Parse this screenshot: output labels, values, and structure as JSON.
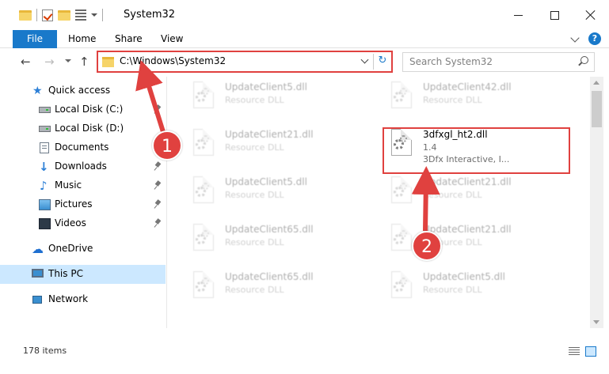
{
  "window": {
    "title": "System32"
  },
  "ribbon": {
    "tabs": [
      {
        "label": "File"
      },
      {
        "label": "Home"
      },
      {
        "label": "Share"
      },
      {
        "label": "View"
      }
    ]
  },
  "nav": {
    "address": "C:\\Windows\\System32",
    "search_placeholder": "Search System32"
  },
  "sidebar": {
    "items": [
      {
        "label": "Quick access",
        "icon": "star-icon"
      },
      {
        "label": "Local Disk (C:)",
        "icon": "drive-icon"
      },
      {
        "label": "Local Disk (D:)",
        "icon": "drive-icon"
      },
      {
        "label": "Documents",
        "icon": "documents-icon"
      },
      {
        "label": "Downloads",
        "icon": "download-icon"
      },
      {
        "label": "Music",
        "icon": "music-icon"
      },
      {
        "label": "Pictures",
        "icon": "pictures-icon"
      },
      {
        "label": "Videos",
        "icon": "videos-icon"
      },
      {
        "label": "OneDrive",
        "icon": "cloud-icon"
      },
      {
        "label": "This PC",
        "icon": "computer-icon"
      },
      {
        "label": "Network",
        "icon": "network-icon"
      }
    ]
  },
  "files": [
    {
      "name": "UpdateClient5.dll",
      "type": "Resource DLL"
    },
    {
      "name": "UpdateClient42.dll",
      "type": "Resource DLL"
    },
    {
      "name": "UpdateClient21.dll",
      "type": "Resource DLL"
    },
    {
      "name": "3dfxgl_ht2.dll",
      "version": "1.4",
      "company": "3Dfx Interactive, I..."
    },
    {
      "name": "UpdateClient5.dll",
      "type": "Resource DLL"
    },
    {
      "name": "UpdateClient21.dll",
      "type": "Resource DLL"
    },
    {
      "name": "UpdateClient65.dll",
      "type": "Resource DLL"
    },
    {
      "name": "UpdateClient21.dll",
      "type": "Resource DLL"
    },
    {
      "name": "UpdateClient65.dll",
      "type": "Resource DLL"
    },
    {
      "name": "UpdateClient5.dll",
      "type": "Resource DLL"
    }
  ],
  "status": {
    "item_count": "178 items"
  },
  "callouts": {
    "one": "1",
    "two": "2"
  },
  "colors": {
    "accent": "#1979ca",
    "highlight_red": "#e0413f",
    "selection": "#cce8ff"
  }
}
